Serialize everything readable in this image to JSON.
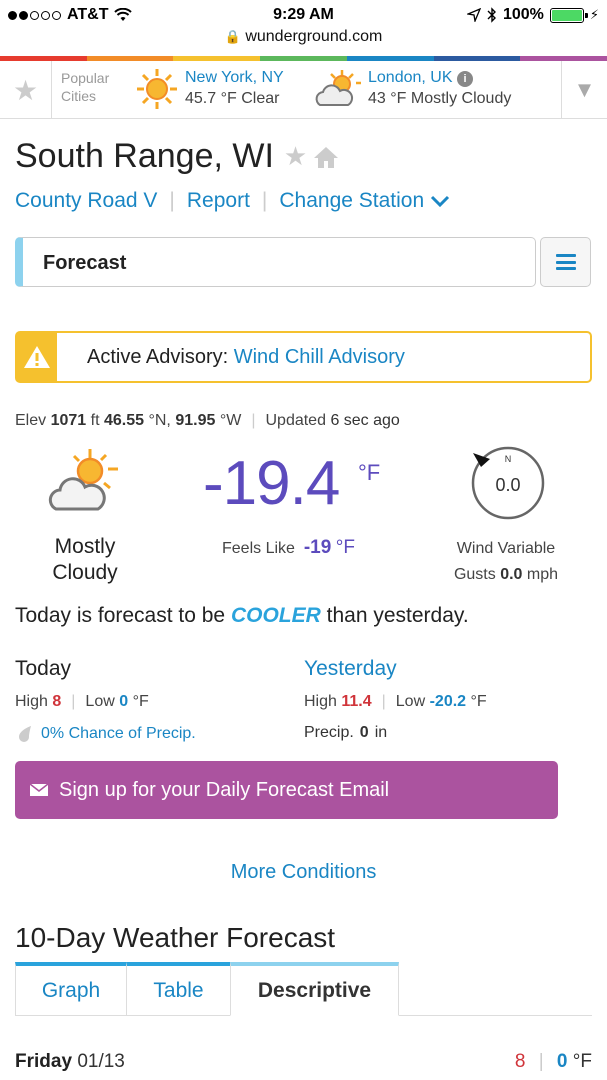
{
  "status_bar": {
    "carrier": "AT&T",
    "time": "9:29 AM",
    "battery": "100%",
    "url": "wunderground.com"
  },
  "colors": {
    "accent": "#1a86c4",
    "temp": "#5c4bbd",
    "high": "#d0343a",
    "advisory": "#f5c12e",
    "signup": "#ab539f"
  },
  "popular": {
    "label_line1": "Popular",
    "label_line2": "Cities",
    "cities": [
      {
        "name": "New York, NY",
        "temp": "45.7 °F",
        "cond": "Clear",
        "icon": "sun-icon"
      },
      {
        "name": "London, UK",
        "temp": "43 °F",
        "cond": "Mostly Cloudy",
        "icon": "partly-cloudy-icon"
      }
    ]
  },
  "location": {
    "title": "South Range, WI",
    "station": "County Road V",
    "report": "Report",
    "change_station": "Change Station"
  },
  "forecast_select": {
    "value": "Forecast"
  },
  "advisory": {
    "prefix": "Active Advisory:",
    "link": "Wind Chill Advisory"
  },
  "elevation": {
    "elev_label": "Elev",
    "elev_value": "1071",
    "elev_unit": "ft",
    "lat": "46.55",
    "lat_dir": "°N,",
    "lon": "91.95",
    "lon_dir": "°W",
    "updated_label": "Updated",
    "updated_value": "6 sec ago"
  },
  "current": {
    "condition_line1": "Mostly",
    "condition_line2": "Cloudy",
    "temperature": "-19.4",
    "unit": "°F",
    "feels_label": "Feels Like",
    "feels_value": "-19",
    "feels_unit": "°F",
    "wind_dir": "N",
    "wind_speed": "0.0",
    "wind_label": "Wind Variable",
    "gusts_label": "Gusts",
    "gusts_value": "0.0",
    "gusts_unit": "mph"
  },
  "comparison": {
    "prefix": "Today is forecast to be",
    "word": "COOLER",
    "suffix": "than yesterday."
  },
  "today": {
    "title": "Today",
    "high_label": "High",
    "high": "8",
    "low_label": "Low",
    "low": "0",
    "unit": "°F",
    "precip": "0% Chance of Precip."
  },
  "yesterday": {
    "title": "Yesterday",
    "high_label": "High",
    "high": "11.4",
    "low_label": "Low",
    "low": "-20.2",
    "unit": "°F",
    "precip_label": "Precip.",
    "precip_value": "0",
    "precip_unit": "in"
  },
  "signup": {
    "label": "Sign up for your Daily Forecast Email"
  },
  "more_conditions": "More Conditions",
  "ten_day": {
    "title": "10-Day Weather Forecast",
    "tabs": [
      "Graph",
      "Table",
      "Descriptive"
    ],
    "active_tab": "Descriptive",
    "first_day": {
      "day": "Friday",
      "date": "01/13",
      "high": "8",
      "low": "0",
      "unit": "°F"
    }
  }
}
